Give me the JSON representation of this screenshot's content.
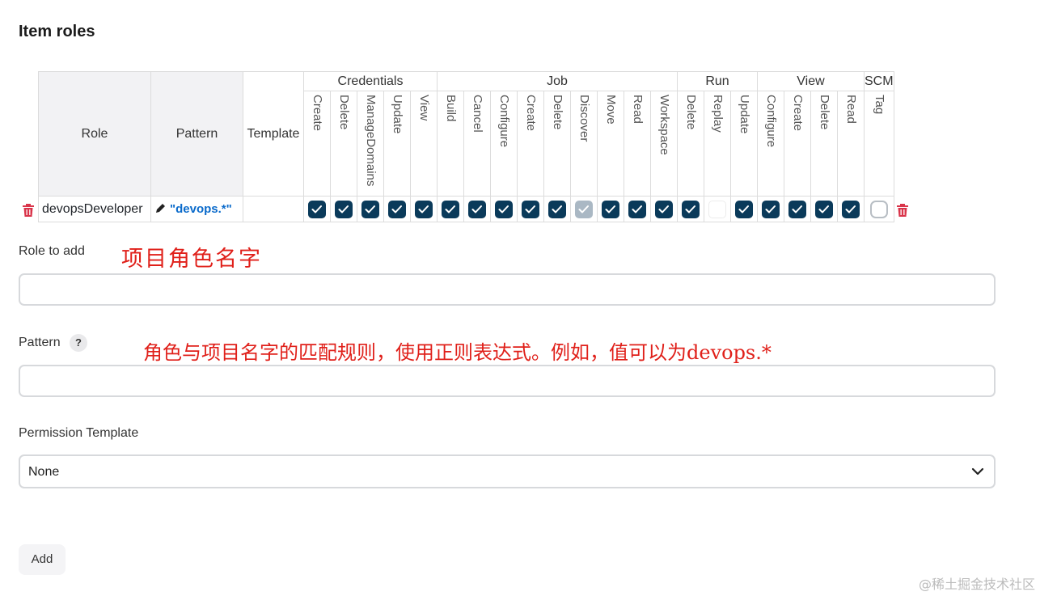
{
  "section": {
    "title": "Item roles"
  },
  "table": {
    "headers": {
      "role": "Role",
      "pattern": "Pattern",
      "template": "Template"
    },
    "groups": [
      {
        "name": "Credentials",
        "perms": [
          "Create",
          "Delete",
          "ManageDomains",
          "Update",
          "View"
        ]
      },
      {
        "name": "Job",
        "perms": [
          "Build",
          "Cancel",
          "Configure",
          "Create",
          "Delete",
          "Discover",
          "Move",
          "Read",
          "Workspace"
        ]
      },
      {
        "name": "Run",
        "perms": [
          "Delete",
          "Replay",
          "Update"
        ]
      },
      {
        "name": "View",
        "perms": [
          "Configure",
          "Create",
          "Delete",
          "Read"
        ]
      },
      {
        "name": "SCM",
        "perms": [
          "Tag"
        ]
      }
    ],
    "rows": [
      {
        "role": "devopsDeveloper",
        "pattern": "\"devops.*\"",
        "template": "",
        "states": [
          "checked",
          "checked",
          "checked",
          "checked",
          "checked",
          "checked",
          "checked",
          "checked",
          "checked",
          "checked",
          "disabled",
          "checked",
          "checked",
          "checked",
          "checked",
          "empty",
          "checked",
          "checked",
          "checked",
          "checked",
          "checked",
          "unchecked"
        ]
      }
    ]
  },
  "form": {
    "role_to_add": {
      "label": "Role to add",
      "value": "",
      "annotation": "项目角色名字"
    },
    "pattern": {
      "label": "Pattern",
      "help": "?",
      "value": "",
      "annotation": "角色与项目名字的匹配规则，使用正则表达式。例如，值可以为devops.*"
    },
    "permission_template": {
      "label": "Permission Template",
      "selected": "None"
    },
    "add_button": "Add"
  },
  "watermark": "@稀土掘金技术社区",
  "colors": {
    "checkbox": "#0a3a5a",
    "checkbox_disabled": "#aab8c4",
    "annotation": "#e0201a",
    "link": "#0b6bcb",
    "trash": "#d9344a"
  }
}
